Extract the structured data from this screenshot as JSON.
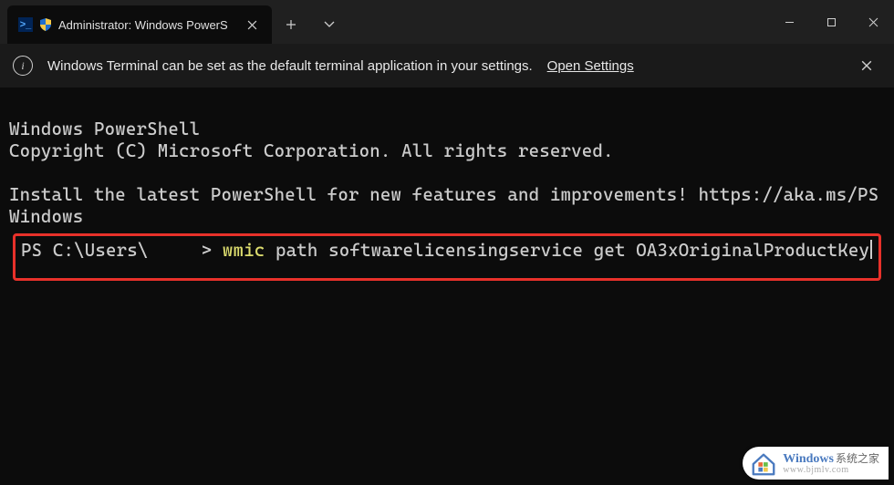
{
  "titlebar": {
    "tab_title": "Administrator: Windows PowerS"
  },
  "infobar": {
    "message": "Windows Terminal can be set as the default terminal application in your settings.",
    "link_label": "Open Settings"
  },
  "terminal": {
    "line1": "Windows PowerShell",
    "line2": "Copyright (C) Microsoft Corporation. All rights reserved.",
    "line3": "Install the latest PowerShell for new features and improvements! https://aka.ms/PSWindows",
    "prompt": "PS C:\\Users\\     > ",
    "cmd_keyword": "wmic",
    "cmd_rest": " path softwarelicensingservice get OA3xOriginalProductKey"
  },
  "watermark": {
    "brand": "Windows",
    "suffix": "系统之家",
    "url": "www.bjmlv.com"
  }
}
